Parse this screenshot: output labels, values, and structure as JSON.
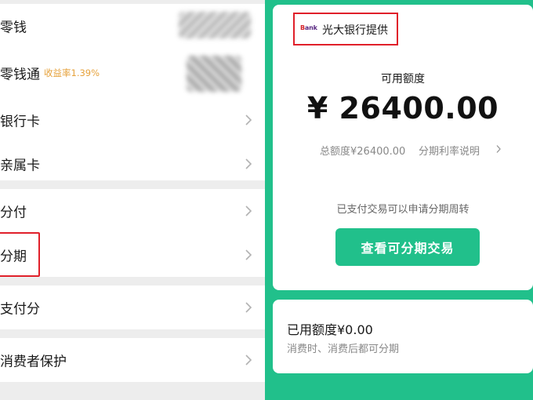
{
  "left_menu": {
    "items": [
      {
        "label": "零钱"
      },
      {
        "label": "零钱通",
        "badge": "收益率1.39%"
      },
      {
        "label": "银行卡"
      },
      {
        "label": "亲属卡"
      },
      {
        "label": "分付"
      },
      {
        "label": "分期"
      },
      {
        "label": "支付分"
      },
      {
        "label": "消费者保护"
      }
    ]
  },
  "installment": {
    "bank_logo": "Bank",
    "provider": "光大银行提供",
    "available_label": "可用额度",
    "available_amount": "¥ 26400.00",
    "total_limit": "总额度¥26400.00",
    "rate_link": "分期利率说明",
    "hint": "已支付交易可以申请分期周转",
    "button_label": "查看可分期交易",
    "used_label": "已用额度¥0.00",
    "used_sub": "消费时、消费后都可分期"
  },
  "colors": {
    "accent_green": "#21c08b",
    "highlight_red": "#e0202a",
    "rate_orange": "#e6a23c"
  }
}
